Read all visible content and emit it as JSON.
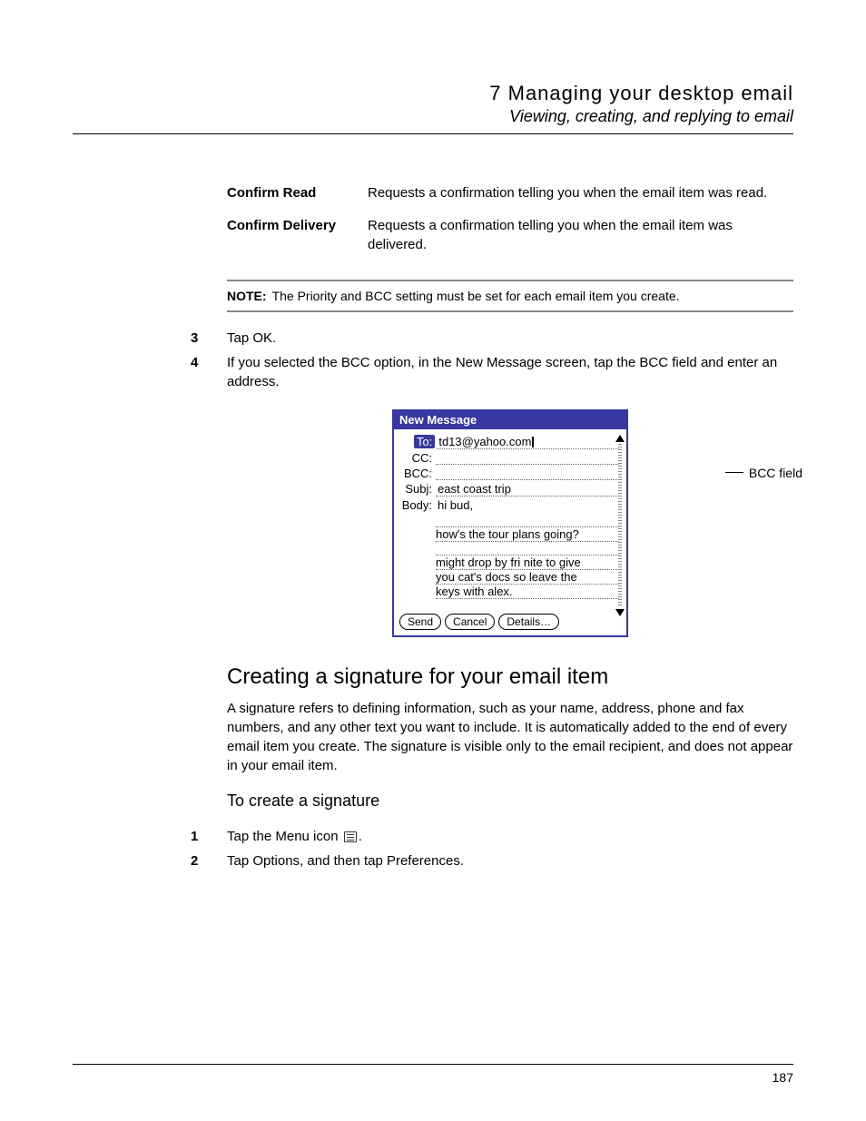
{
  "header": {
    "chapter": "7 Managing your desktop email",
    "section": "Viewing, creating, and replying to email"
  },
  "definitions": [
    {
      "term": "Confirm Read",
      "desc": "Requests a confirmation telling you when the email item was read."
    },
    {
      "term": "Confirm Delivery",
      "desc": "Requests a confirmation telling you when the email item was delivered."
    }
  ],
  "note": {
    "label": "NOTE:",
    "text": "The Priority and BCC setting must be set for each email item you create."
  },
  "steps_a": [
    {
      "num": "3",
      "text": "Tap OK."
    },
    {
      "num": "4",
      "text": "If you selected the BCC option, in the New Message screen, tap the BCC field and enter an address."
    }
  ],
  "figure": {
    "title": "New Message",
    "to_label": "To:",
    "to_value": "td13@yahoo.com",
    "cc_label": "CC:",
    "cc_value": "",
    "bcc_label": "BCC:",
    "bcc_value": "",
    "subj_label": "Subj:",
    "subj_value": "east coast trip",
    "body_label": "Body:",
    "body_lines": [
      "hi bud,",
      "",
      "how's the tour plans going?",
      "",
      "might drop by fri nite to give",
      "you cat's docs so leave the",
      "keys with alex."
    ],
    "buttons": {
      "send": "Send",
      "cancel": "Cancel",
      "details": "Details…"
    },
    "callout": "BCC field"
  },
  "section2": {
    "heading": "Creating a signature for your email item",
    "para": "A signature refers to defining information, such as your name, address, phone and fax numbers, and any other text you want to include. It is automatically added to the end of every email item you create. The signature is visible only to the email recipient, and does not appear in your email item.",
    "subheading": "To create a signature",
    "steps": [
      {
        "num": "1",
        "text_before": "Tap the Menu icon ",
        "text_after": "."
      },
      {
        "num": "2",
        "text": "Tap Options, and then tap Preferences."
      }
    ]
  },
  "page_number": "187"
}
